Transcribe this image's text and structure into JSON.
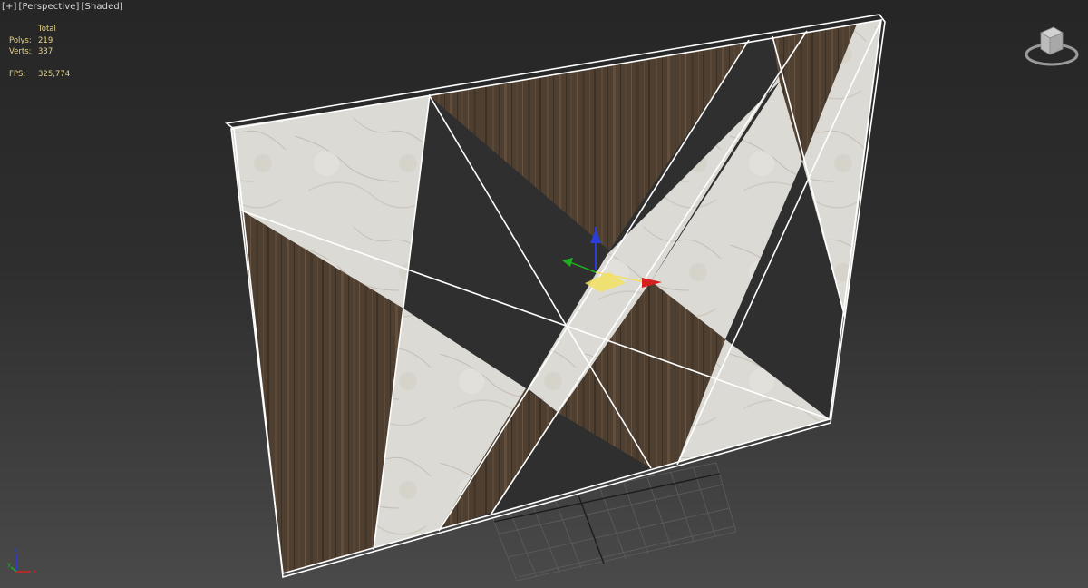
{
  "viewport": {
    "labels": {
      "plus": "[+]",
      "view": "[Perspective]",
      "shading": "[Shaded]"
    },
    "stats": {
      "header": "Total",
      "polys_label": "Polys:",
      "polys_value": "219",
      "verts_label": "Verts:",
      "verts_value": "337",
      "fps_label": "FPS:",
      "fps_value": "325,774"
    },
    "tripod": {
      "x_label": "x",
      "y_label": "y",
      "z_label": "z"
    }
  },
  "colors": {
    "viewport_bg_top": "#262626",
    "viewport_bg_bottom": "#4a4a4a",
    "stats_text": "#e6d48a",
    "selection_outline": "#ffffff",
    "marble": "#dcdad4",
    "wood": "#4e3f31",
    "axis_x": "#d62020",
    "axis_y": "#1fae1f",
    "axis_z": "#2a3fd8",
    "gizmo_plane": "#f2e060"
  },
  "icons": {
    "viewcube": "viewcube-icon",
    "gizmo": "move-gizmo-icon",
    "tripod": "world-axis-tripod-icon"
  }
}
